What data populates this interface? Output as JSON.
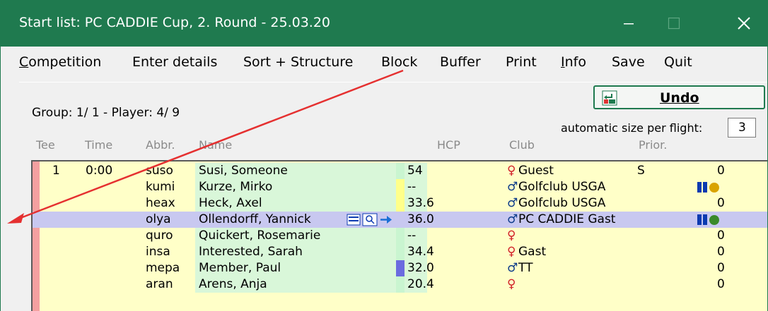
{
  "window": {
    "title": "Start list: PC CADDIE Cup, 2. Round - 25.03.20",
    "controls": {
      "minimize": "minimize-icon",
      "maximize": "maximize-icon",
      "close": "close-icon"
    }
  },
  "menu": [
    {
      "label": "Competition",
      "underline_index": 0
    },
    {
      "label": "Enter details"
    },
    {
      "label": "Sort + Structure"
    },
    {
      "label": "Block"
    },
    {
      "label": "Buffer"
    },
    {
      "label": "Print"
    },
    {
      "label": "Info",
      "underline_index": 0
    },
    {
      "label": "Save"
    },
    {
      "label": "Quit"
    }
  ],
  "group_info": "Group:  1/ 1 - Player:  4/  9",
  "undo_button": {
    "label": "Undo",
    "icon": "undo-icon"
  },
  "auto_size": {
    "label": "automatic size per flight:",
    "value": "3"
  },
  "columns": [
    "Tee",
    "Time",
    "Abbr.",
    "Name",
    "HCP",
    "Club",
    "Prior."
  ],
  "rows": [
    {
      "tee": "1",
      "time": "0:00",
      "abbr": "suso",
      "name": "Susi, Someone",
      "hcp": "54",
      "gender": "female",
      "club": "Guest",
      "prior": "S",
      "count": "0",
      "hcp_color": "#c9f5d0"
    },
    {
      "tee": "",
      "time": "",
      "abbr": "kumi",
      "name": "Kurze, Mirko",
      "hcp": "--",
      "gender": "male",
      "club": "Golfclub USGA",
      "prior": "",
      "count": "",
      "hcp_color": "#ffff8a",
      "badge": "info-trophy-icon"
    },
    {
      "tee": "",
      "time": "",
      "abbr": "heax",
      "name": "Heck, Axel",
      "hcp": "33.6",
      "gender": "male",
      "club": "Golfclub USGA",
      "prior": "",
      "count": "0",
      "hcp_color": "#ffff8a"
    },
    {
      "tee": "",
      "time": "",
      "abbr": "olya",
      "name": "Ollendorff, Yannick",
      "hcp": "36.0",
      "gender": "male",
      "club": "PC CADDIE Gast",
      "prior": "",
      "count": "",
      "hcp_color": "#c8c8f0",
      "selected": true,
      "badge": "info-turtle-icon"
    },
    {
      "tee": "",
      "time": "",
      "abbr": "quro",
      "name": "Quickert, Rosemarie",
      "hcp": "--",
      "gender": "female",
      "club": "",
      "prior": "",
      "count": "0",
      "hcp_color": "#c9f5d0"
    },
    {
      "tee": "",
      "time": "",
      "abbr": "insa",
      "name": "Interested, Sarah",
      "hcp": "34.4",
      "gender": "female",
      "club": "Gast",
      "prior": "",
      "count": "0",
      "hcp_color": "#c9f5d0"
    },
    {
      "tee": "",
      "time": "",
      "abbr": "mepa",
      "name": "Member, Paul",
      "hcp": "32.0",
      "gender": "male",
      "club": "TT",
      "prior": "",
      "count": "0",
      "hcp_color": "#6b6bdf"
    },
    {
      "tee": "",
      "time": "",
      "abbr": "aran",
      "name": "Arens, Anja",
      "hcp": "20.4",
      "gender": "female",
      "club": "",
      "prior": "",
      "count": "0",
      "hcp_color": "#c9f5d0"
    }
  ],
  "colors": {
    "accent": "#1f7a4f",
    "grid_bg": "#ffffc8",
    "selected": "#c8c8f0",
    "tee_marker": "#f4a0a0",
    "arrow": "#e53030"
  }
}
